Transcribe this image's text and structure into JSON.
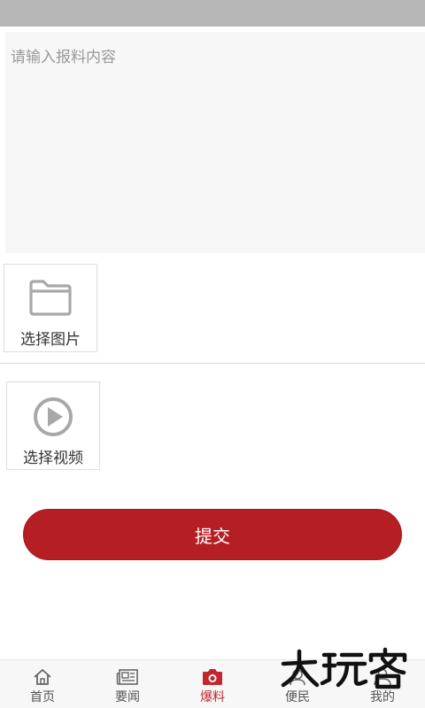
{
  "form": {
    "content_placeholder": "请输入报料内容",
    "content_value": ""
  },
  "media": {
    "image_label": "选择图片",
    "video_label": "选择视频"
  },
  "submit_label": "提交",
  "tabbar": {
    "tabs": [
      {
        "label": "首页",
        "icon": "home-icon",
        "active": false
      },
      {
        "label": "要闻",
        "icon": "newspaper-icon",
        "active": false
      },
      {
        "label": "爆料",
        "icon": "camera-icon",
        "active": true
      },
      {
        "label": "便民",
        "icon": "service-icon",
        "active": false
      },
      {
        "label": "我的",
        "icon": "user-icon",
        "active": false
      }
    ]
  },
  "watermark": {
    "text": "大玩客"
  },
  "colors": {
    "accent": "#b51f24",
    "status_bar": "#b7b7b7",
    "input_background": "#f7f7f7",
    "icon_gray": "#a8a8a8"
  }
}
